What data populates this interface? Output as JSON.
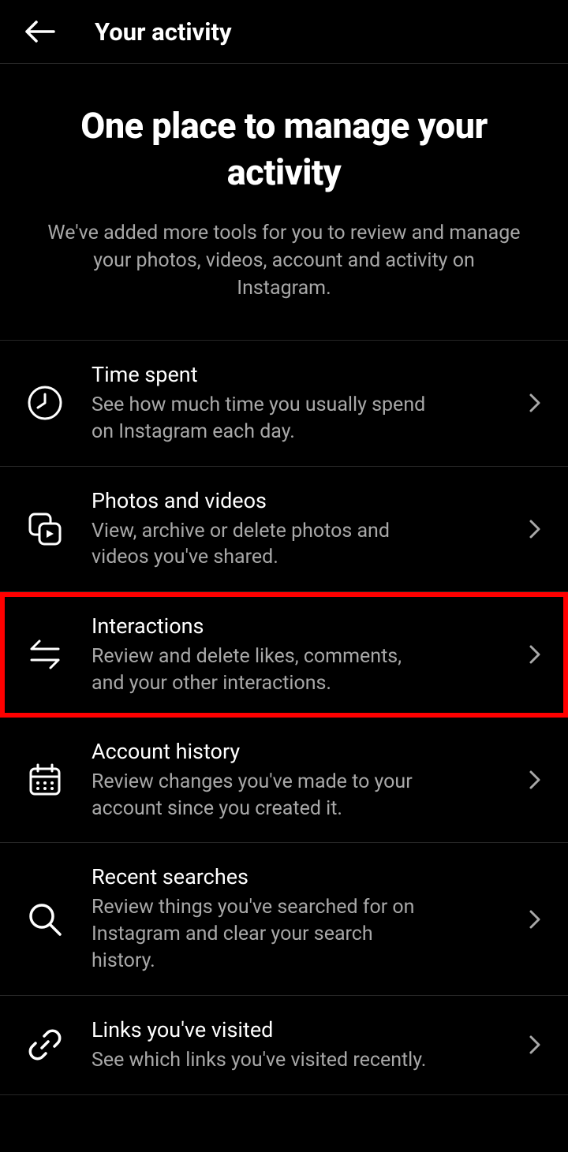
{
  "header": {
    "title": "Your activity"
  },
  "intro": {
    "title": "One place to manage your activity",
    "subtitle": "We've added more tools for you to review and manage your photos, videos, account and activity on Instagram."
  },
  "items": [
    {
      "title": "Time spent",
      "subtitle": "See how much time you usually spend on Instagram each day."
    },
    {
      "title": "Photos and videos",
      "subtitle": "View, archive or delete photos and videos you've shared."
    },
    {
      "title": "Interactions",
      "subtitle": "Review and delete likes, comments, and your other interactions."
    },
    {
      "title": "Account history",
      "subtitle": "Review changes you've made to your account since you created it."
    },
    {
      "title": "Recent searches",
      "subtitle": "Review things you've searched for on Instagram and clear your search history."
    },
    {
      "title": "Links you've visited",
      "subtitle": "See which links you've visited recently."
    }
  ],
  "highlighted_index": 2
}
